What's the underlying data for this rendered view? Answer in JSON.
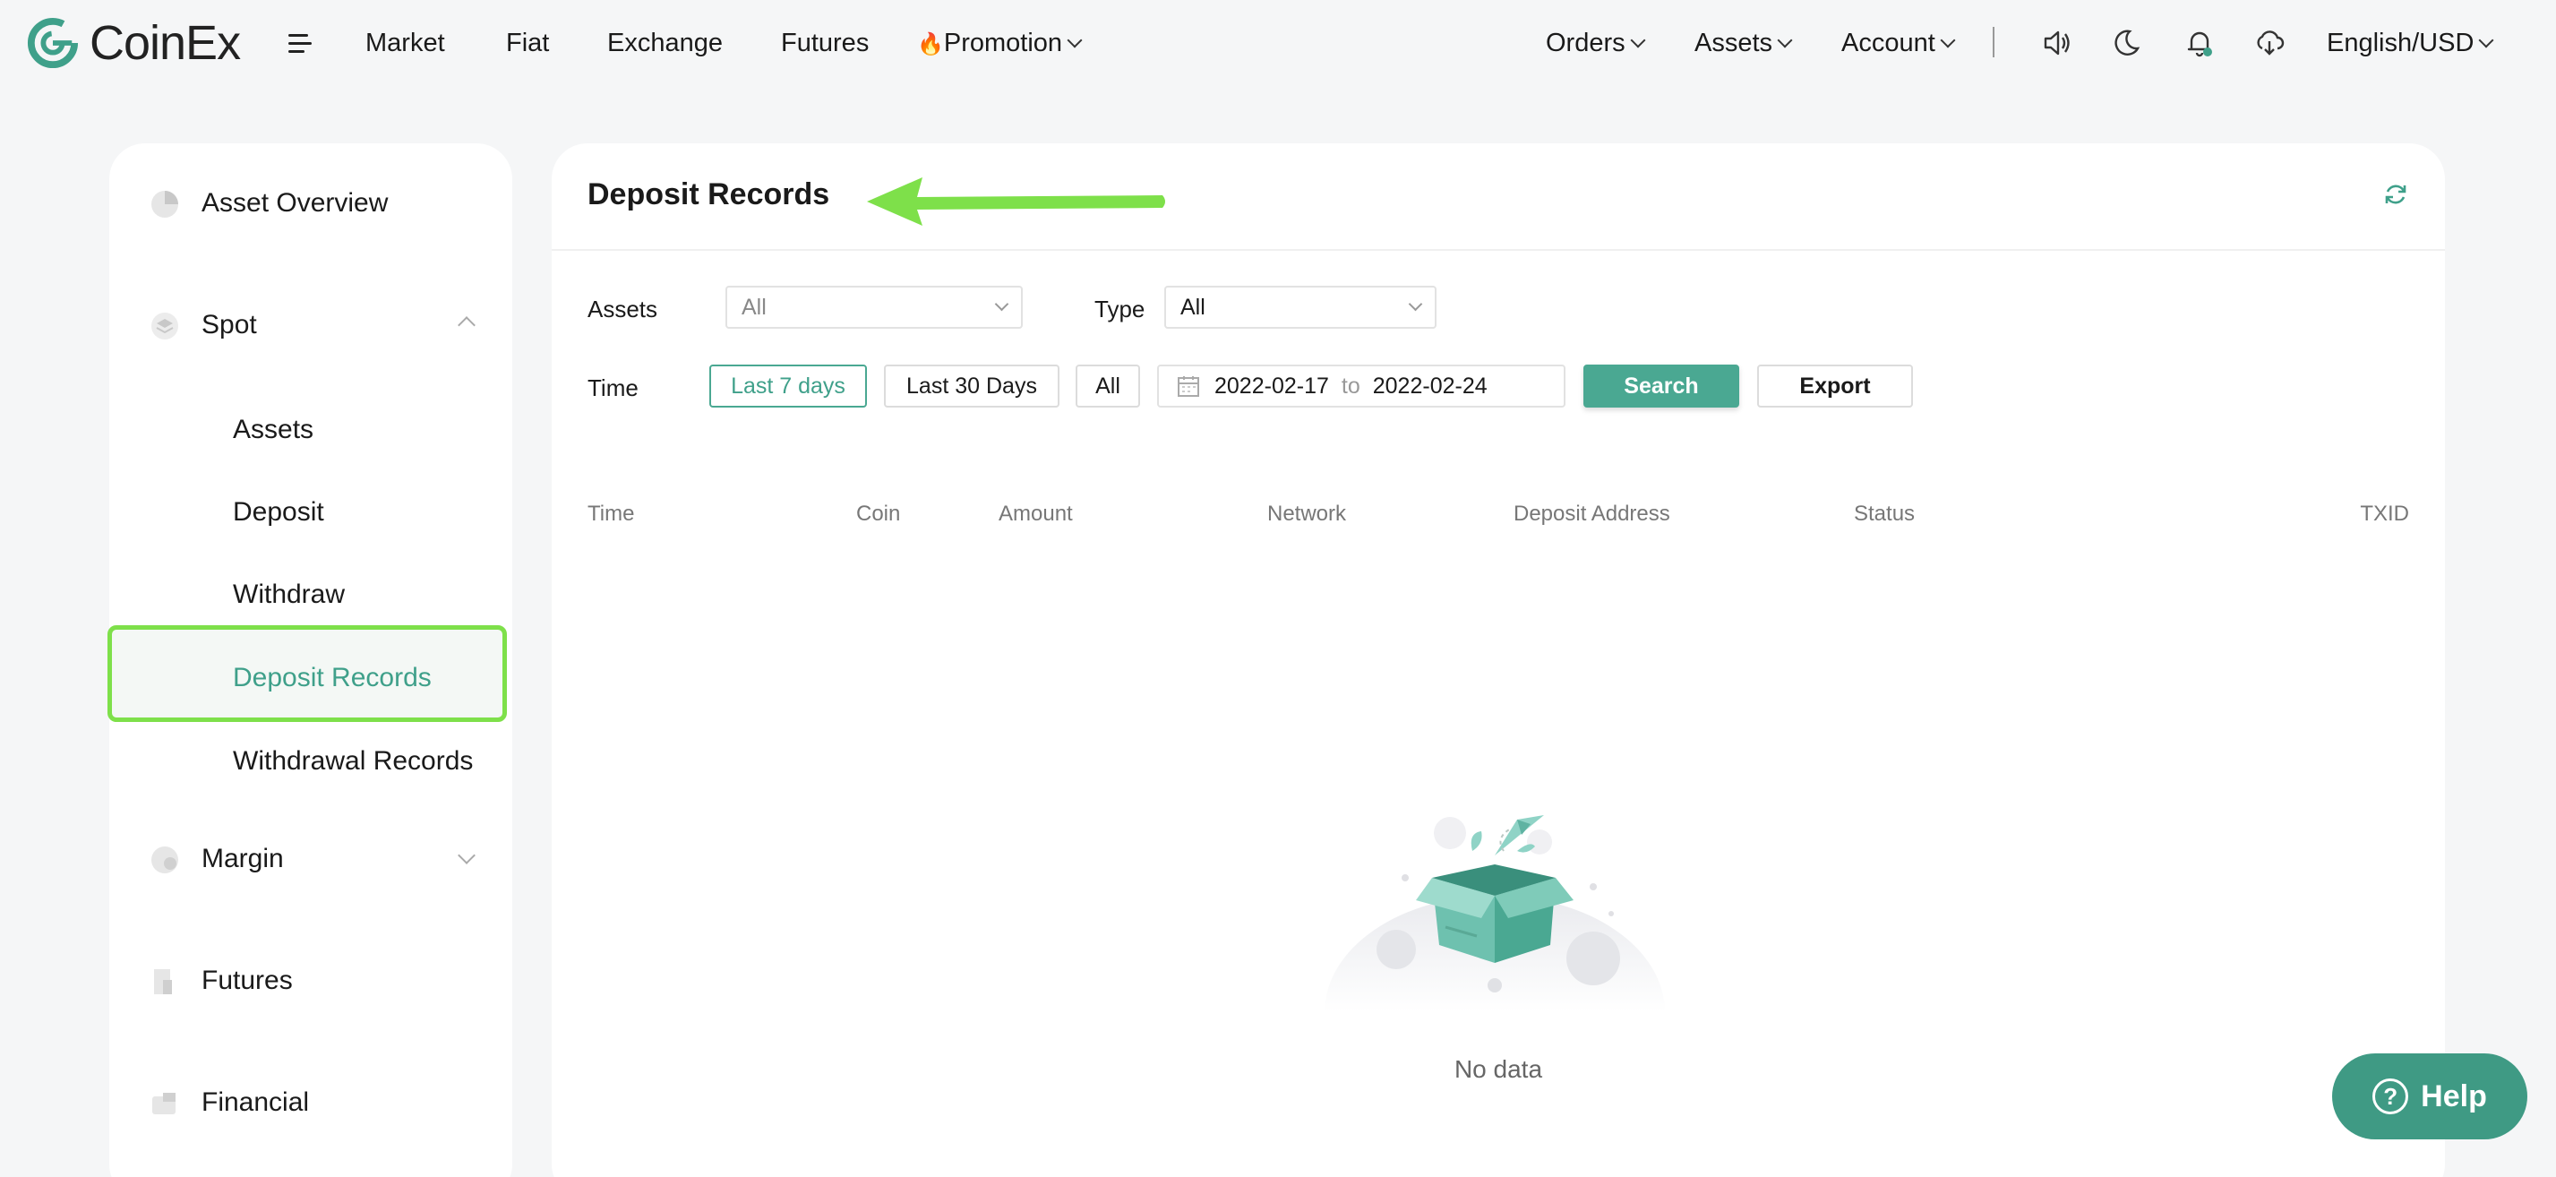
{
  "brand": {
    "name": "CoinEx",
    "color": "#3fa08a"
  },
  "nav": {
    "menu_icon": "hamburger-icon",
    "left_items": [
      "Market",
      "Fiat",
      "Exchange",
      "Futures"
    ],
    "promotion": {
      "emoji": "🔥",
      "label": "Promotion"
    },
    "right_items": [
      "Orders",
      "Assets",
      "Account"
    ],
    "icons": [
      "speaker-icon",
      "moon-icon",
      "bell-icon",
      "download-icon"
    ],
    "locale": "English/USD"
  },
  "sidebar": {
    "asset_overview": "Asset Overview",
    "spot": {
      "label": "Spot",
      "children": [
        "Assets",
        "Deposit",
        "Withdraw",
        "Deposit Records",
        "Withdrawal Records"
      ],
      "active": "Deposit Records"
    },
    "margin": "Margin",
    "futures": "Futures",
    "financial": "Financial",
    "highlight_color": "#7ee04a"
  },
  "main": {
    "title": "Deposit Records",
    "filters": {
      "assets_label": "Assets",
      "assets_value": "All",
      "type_label": "Type",
      "type_value": "All",
      "time_label": "Time",
      "time_buttons": [
        "Last 7 days",
        "Last 30 Days",
        "All"
      ],
      "active_time": "Last 7 days",
      "date_from": "2022-02-17",
      "date_to_word": "to",
      "date_to": "2022-02-24",
      "search_label": "Search",
      "export_label": "Export"
    },
    "table": {
      "columns": [
        "Time",
        "Coin",
        "Amount",
        "Network",
        "Deposit Address",
        "Status",
        "TXID"
      ],
      "rows": []
    },
    "empty_text": "No data"
  },
  "help": {
    "label": "Help"
  },
  "accent_color": "#4aa892"
}
